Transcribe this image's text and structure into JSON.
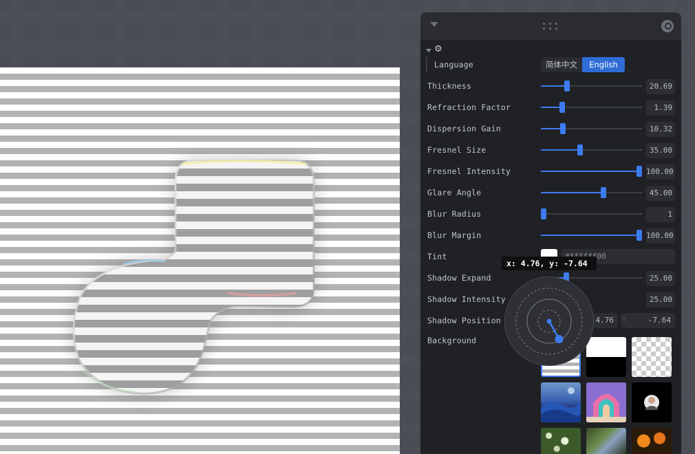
{
  "panel": {
    "language": {
      "label": "Language",
      "options": [
        "简体中文",
        "English"
      ],
      "selected": "English"
    },
    "params": [
      {
        "key": "thickness",
        "label": "Thickness",
        "value_text": "20.69",
        "fraction": 0.26
      },
      {
        "key": "refraction",
        "label": "Refraction Factor",
        "value_text": "1.39",
        "fraction": 0.21
      },
      {
        "key": "dispersion",
        "label": "Dispersion Gain",
        "value_text": "10.32",
        "fraction": 0.22
      },
      {
        "key": "fresnel-size",
        "label": "Fresnel Size",
        "value_text": "35.00",
        "fraction": 0.39
      },
      {
        "key": "fresnel-intensity",
        "label": "Fresnel Intensity",
        "value_text": "100.00",
        "fraction": 0.98
      },
      {
        "key": "glare-angle",
        "label": "Glare Angle",
        "value_text": "45.00",
        "fraction": 0.62
      },
      {
        "key": "blur-radius",
        "label": "Blur Radius",
        "value_text": "1",
        "fraction": 0.02
      },
      {
        "key": "blur-margin",
        "label": "Blur Margin",
        "value_text": "100.00",
        "fraction": 0.98
      }
    ],
    "tint": {
      "label": "Tint",
      "value": "#ffffff00",
      "swatch_color": "#ffffff"
    },
    "shadow_expand": {
      "label": "Shadow Expand",
      "value_text": "25.00",
      "fraction": 0.25
    },
    "shadow_intensity": {
      "label": "Shadow Intensity",
      "value_text": "25.00"
    },
    "shadow_position": {
      "label": "Shadow Position",
      "x": "4.76",
      "y": "-7.64",
      "y_prefix": "Y"
    },
    "background": {
      "label": "Background"
    },
    "tooltip": "x: 4.76, y: -7.64"
  },
  "colors": {
    "accent": "#3d7cf0",
    "panel_bg": "#1f2125",
    "page_bg": "#25272b"
  }
}
